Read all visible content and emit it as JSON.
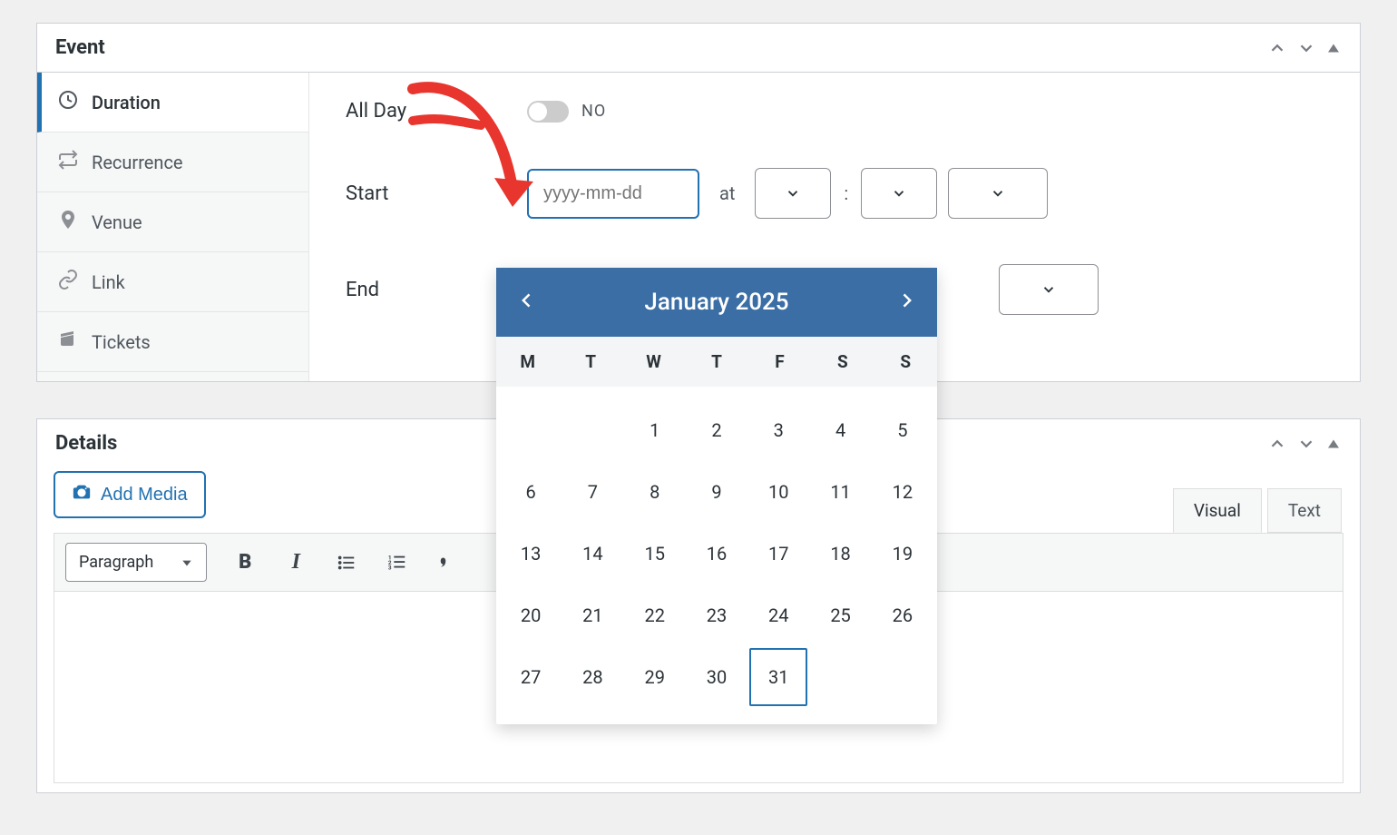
{
  "panels": {
    "event": {
      "title": "Event",
      "tabs": {
        "duration": "Duration",
        "recurrence": "Recurrence",
        "venue": "Venue",
        "link": "Link",
        "tickets": "Tickets"
      },
      "form": {
        "all_day_label": "All Day",
        "all_day_value": "NO",
        "start_label": "Start",
        "end_label": "End",
        "date_placeholder": "yyyy-mm-dd",
        "at_label": "at",
        "colon_label": ":"
      }
    },
    "details": {
      "title": "Details",
      "add_media": "Add Media",
      "format_label": "Paragraph",
      "tab_visual": "Visual",
      "tab_text": "Text"
    }
  },
  "datepicker": {
    "month_label": "January 2025",
    "weekdays": [
      "M",
      "T",
      "W",
      "T",
      "F",
      "S",
      "S"
    ],
    "leading_blanks": 2,
    "days_in_month": 31,
    "highlighted_day": 31
  }
}
